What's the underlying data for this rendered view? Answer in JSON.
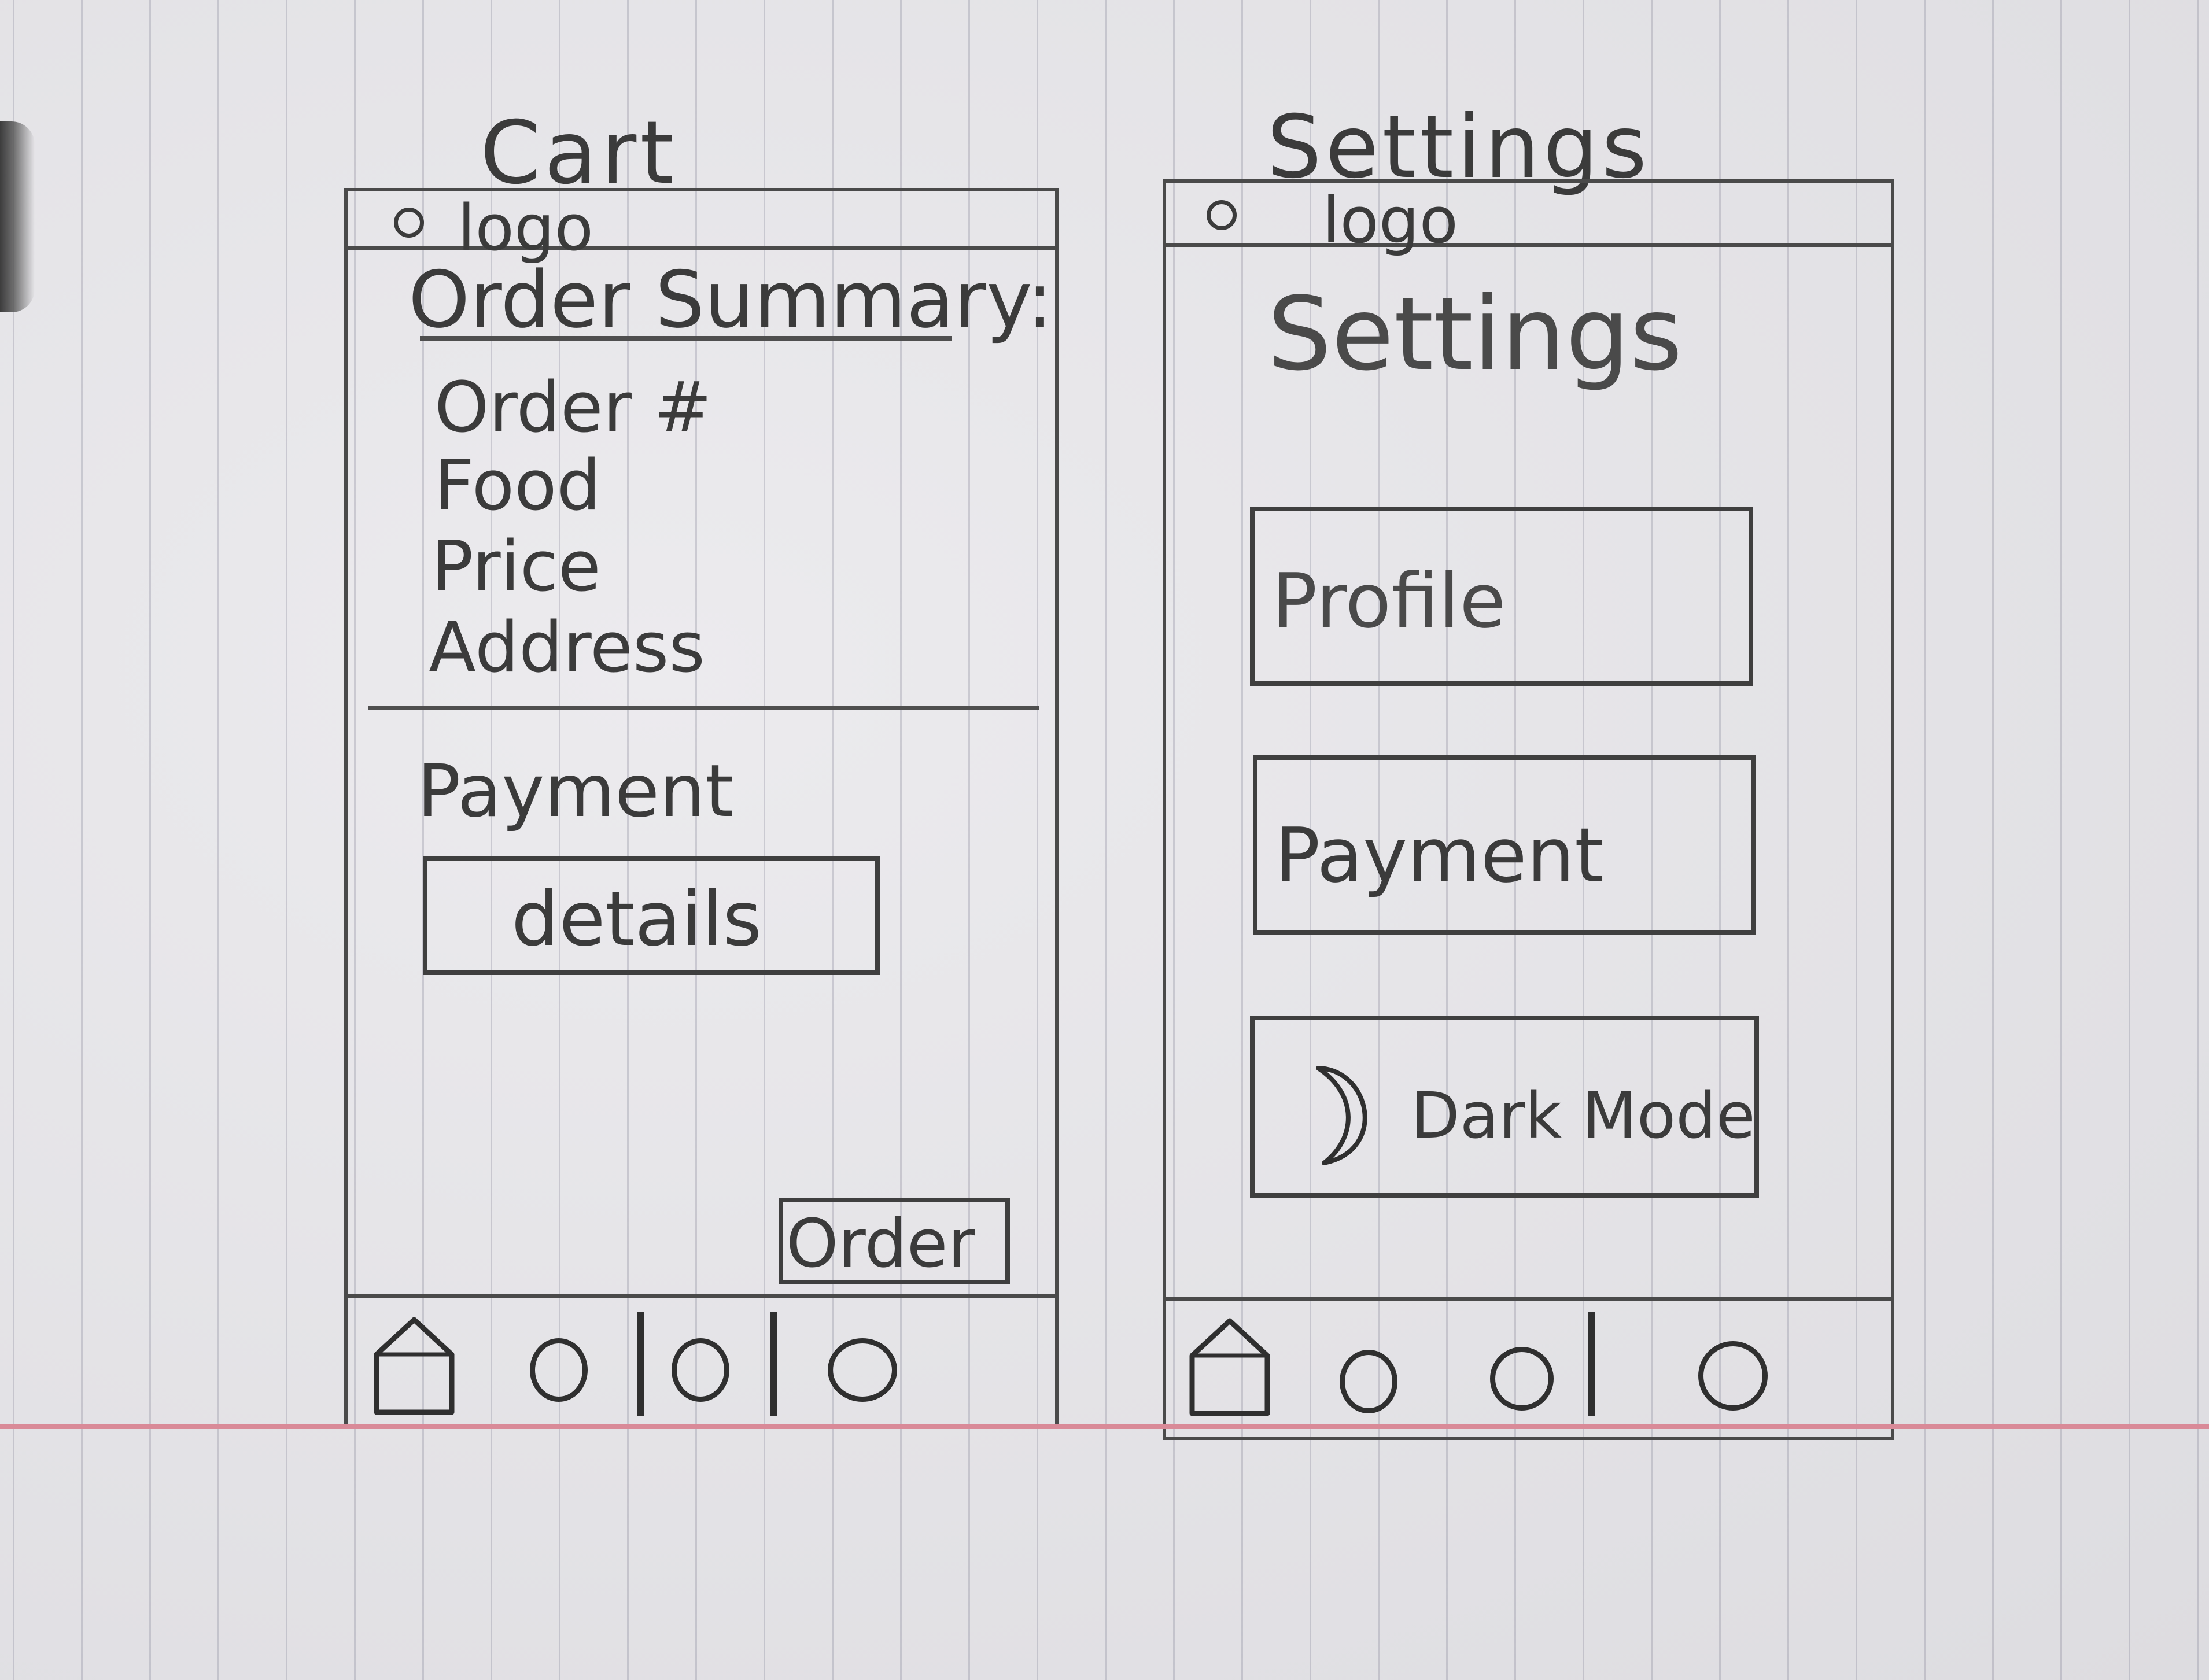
{
  "cart": {
    "title": "Cart",
    "logo_text": "logo",
    "summary_heading": "Order Summary:",
    "summary_items": [
      "Order #",
      "Food",
      "Price",
      "Address"
    ],
    "payment_label": "Payment",
    "details_button": "details",
    "order_button": "Order"
  },
  "settings": {
    "title": "Settings",
    "logo_text": "logo",
    "page_heading": "Settings",
    "profile_button": "Profile",
    "payment_button": "Payment",
    "dark_mode_button": "Dark Mode"
  },
  "icons": [
    "logo-circle-icon",
    "home-icon",
    "circle-icon",
    "moon-icon"
  ]
}
